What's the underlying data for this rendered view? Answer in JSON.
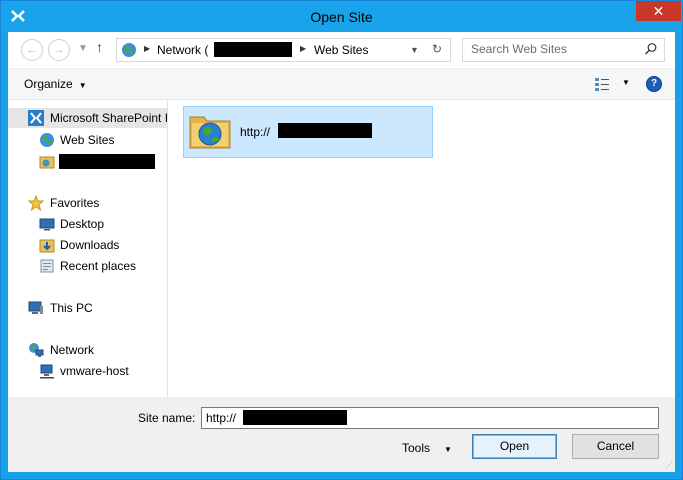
{
  "window": {
    "title": "Open Site",
    "close_glyph": "✕"
  },
  "nav": {
    "back_icon": "back-arrow-icon",
    "forward_icon": "forward-arrow-icon",
    "up_icon": "up-arrow-icon",
    "breadcrumb": [
      "Network (",
      "Web Sites"
    ],
    "search_placeholder": "Search Web Sites"
  },
  "toolbar": {
    "organize_label": "Organize"
  },
  "sidebar": {
    "items": [
      {
        "label": "Microsoft SharePoint I",
        "icon": "sharepoint-icon"
      },
      {
        "label": "Web Sites",
        "icon": "globe-icon"
      },
      {
        "label": "",
        "icon": "site-folder-icon"
      },
      {
        "label": "Favorites",
        "icon": "star-icon"
      },
      {
        "label": "Desktop",
        "icon": "desktop-icon"
      },
      {
        "label": "Downloads",
        "icon": "downloads-folder-icon"
      },
      {
        "label": "Recent places",
        "icon": "recent-places-icon"
      },
      {
        "label": "This PC",
        "icon": "computer-icon"
      },
      {
        "label": "Network",
        "icon": "network-icon"
      },
      {
        "label": "vmware-host",
        "icon": "network-host-icon"
      }
    ]
  },
  "content": {
    "items": [
      {
        "label": "http://",
        "icon": "web-folder-icon"
      }
    ]
  },
  "footer": {
    "site_name_label": "Site name:",
    "site_name_value": "http://",
    "tools_label": "Tools",
    "open_label": "Open",
    "cancel_label": "Cancel"
  },
  "colors": {
    "titlebar": "#19a3ea",
    "selection": "#cce8ff",
    "close": "#c7382b"
  }
}
